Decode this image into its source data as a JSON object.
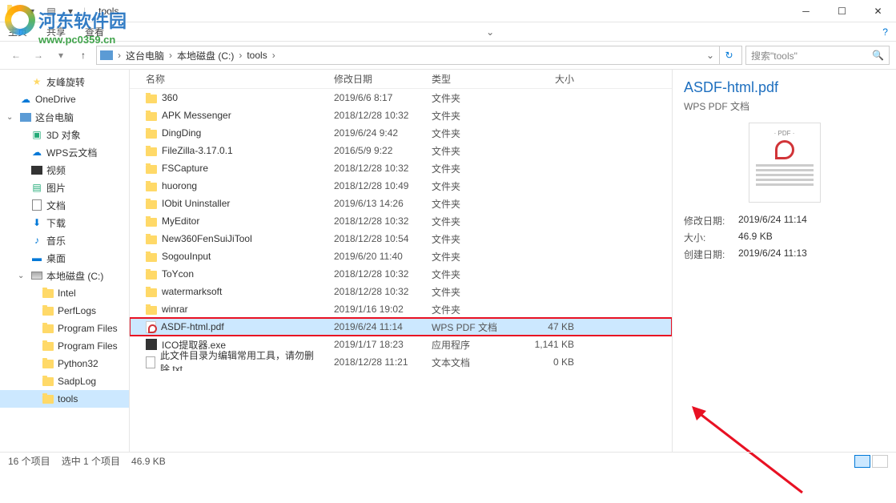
{
  "window": {
    "title": "tools",
    "watermark_text": "河东软件园",
    "watermark_url": "www.pc0359.cn"
  },
  "ribbon": {
    "tabs": [
      "主页",
      "共享",
      "查看"
    ]
  },
  "breadcrumb": {
    "items": [
      "这台电脑",
      "本地磁盘 (C:)",
      "tools"
    ]
  },
  "search": {
    "placeholder": "搜索\"tools\""
  },
  "sidebar": [
    {
      "label": "友峰旋转",
      "icon": "star",
      "indent": 1
    },
    {
      "label": "OneDrive",
      "icon": "cloud",
      "indent": 0
    },
    {
      "label": "这台电脑",
      "icon": "pc",
      "indent": 0,
      "exp": true
    },
    {
      "label": "3D 对象",
      "icon": "3d",
      "indent": 1
    },
    {
      "label": "WPS云文档",
      "icon": "wps",
      "indent": 1
    },
    {
      "label": "视频",
      "icon": "video",
      "indent": 1
    },
    {
      "label": "图片",
      "icon": "pic",
      "indent": 1
    },
    {
      "label": "文档",
      "icon": "doc",
      "indent": 1
    },
    {
      "label": "下载",
      "icon": "dl",
      "indent": 1
    },
    {
      "label": "音乐",
      "icon": "music",
      "indent": 1
    },
    {
      "label": "桌面",
      "icon": "desktop",
      "indent": 1
    },
    {
      "label": "本地磁盘 (C:)",
      "icon": "disk",
      "indent": 1,
      "exp": true
    },
    {
      "label": "Intel",
      "icon": "folder",
      "indent": 2
    },
    {
      "label": "PerfLogs",
      "icon": "folder",
      "indent": 2
    },
    {
      "label": "Program Files",
      "icon": "folder",
      "indent": 2
    },
    {
      "label": "Program Files",
      "icon": "folder",
      "indent": 2
    },
    {
      "label": "Python32",
      "icon": "folder",
      "indent": 2
    },
    {
      "label": "SadpLog",
      "icon": "folder",
      "indent": 2
    },
    {
      "label": "tools",
      "icon": "folder",
      "indent": 2,
      "selected": true
    }
  ],
  "columns": {
    "name": "名称",
    "date": "修改日期",
    "type": "类型",
    "size": "大小"
  },
  "files": [
    {
      "name": "360",
      "date": "2019/6/6 8:17",
      "type": "文件夹",
      "size": "",
      "icon": "folder"
    },
    {
      "name": "APK Messenger",
      "date": "2018/12/28 10:32",
      "type": "文件夹",
      "size": "",
      "icon": "folder"
    },
    {
      "name": "DingDing",
      "date": "2019/6/24 9:42",
      "type": "文件夹",
      "size": "",
      "icon": "folder"
    },
    {
      "name": "FileZilla-3.17.0.1",
      "date": "2016/5/9 9:22",
      "type": "文件夹",
      "size": "",
      "icon": "folder"
    },
    {
      "name": "FSCapture",
      "date": "2018/12/28 10:32",
      "type": "文件夹",
      "size": "",
      "icon": "folder"
    },
    {
      "name": "huorong",
      "date": "2018/12/28 10:49",
      "type": "文件夹",
      "size": "",
      "icon": "folder"
    },
    {
      "name": "IObit Uninstaller",
      "date": "2019/6/13 14:26",
      "type": "文件夹",
      "size": "",
      "icon": "folder"
    },
    {
      "name": "MyEditor",
      "date": "2018/12/28 10:32",
      "type": "文件夹",
      "size": "",
      "icon": "folder"
    },
    {
      "name": "New360FenSuiJiTool",
      "date": "2018/12/28 10:54",
      "type": "文件夹",
      "size": "",
      "icon": "folder"
    },
    {
      "name": "SogouInput",
      "date": "2019/6/20 11:40",
      "type": "文件夹",
      "size": "",
      "icon": "folder"
    },
    {
      "name": "ToYcon",
      "date": "2018/12/28 10:32",
      "type": "文件夹",
      "size": "",
      "icon": "folder"
    },
    {
      "name": "watermarksoft",
      "date": "2018/12/28 10:32",
      "type": "文件夹",
      "size": "",
      "icon": "folder"
    },
    {
      "name": "winrar",
      "date": "2019/1/16 19:02",
      "type": "文件夹",
      "size": "",
      "icon": "folder"
    },
    {
      "name": "ASDF-html.pdf",
      "date": "2019/6/24 11:14",
      "type": "WPS PDF 文档",
      "size": "47 KB",
      "icon": "pdf",
      "selected": true
    },
    {
      "name": "ICO提取器.exe",
      "date": "2019/1/17 18:23",
      "type": "应用程序",
      "size": "1,141 KB",
      "icon": "exe"
    },
    {
      "name": "此文件目录为编辑常用工具，请勿删除.txt",
      "date": "2018/12/28 11:21",
      "type": "文本文档",
      "size": "0 KB",
      "icon": "txt"
    }
  ],
  "preview": {
    "title": "ASDF-html.pdf",
    "subtitle": "WPS PDF 文档",
    "meta": [
      {
        "k": "修改日期:",
        "v": "2019/6/24 11:14"
      },
      {
        "k": "大小:",
        "v": "46.9 KB"
      },
      {
        "k": "创建日期:",
        "v": "2019/6/24 11:13"
      }
    ]
  },
  "status": {
    "count": "16 个项目",
    "selected": "选中 1 个项目",
    "size": "46.9 KB"
  }
}
